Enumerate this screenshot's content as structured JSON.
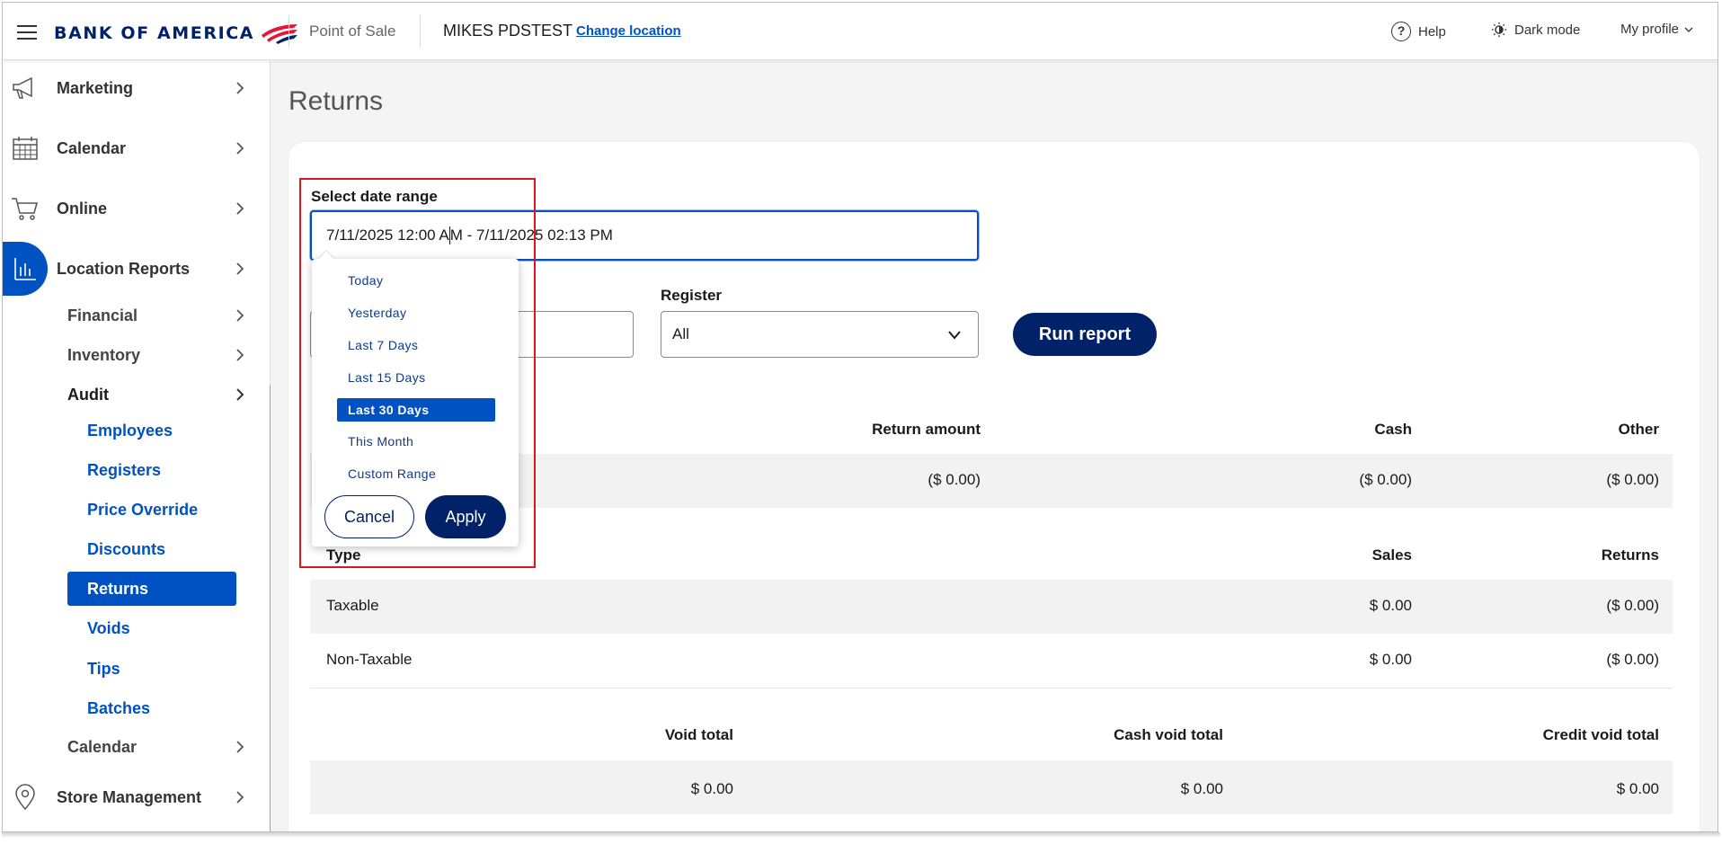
{
  "header": {
    "brand": "BANK OF AMERICA",
    "app_name": "Point of Sale",
    "location_name": "MIKES PDSTEST",
    "change_location": "Change location",
    "help": "Help",
    "dark_mode": "Dark mode",
    "profile": "My profile"
  },
  "sidebar": {
    "top_items": [
      {
        "label": "Marketing",
        "icon": "megaphone-icon"
      },
      {
        "label": "Calendar",
        "icon": "calendar-icon"
      },
      {
        "label": "Online",
        "icon": "cart-icon"
      },
      {
        "label": "Location Reports",
        "icon": "bar-chart-icon",
        "active": true
      },
      {
        "label": "Store Management",
        "icon": "location-pin-icon"
      }
    ],
    "sub_items": [
      "Financial",
      "Inventory",
      "Audit",
      "Calendar"
    ],
    "audit_items": [
      "Employees",
      "Registers",
      "Price Override",
      "Discounts",
      "Returns",
      "Voids",
      "Tips",
      "Batches"
    ],
    "selected": "Returns"
  },
  "main": {
    "title": "Returns",
    "date_label": "Select date range",
    "date_value_a": "7/11/2025 12:00 A",
    "date_value_b": "M - 7/11/2025 02:13 PM",
    "register_label": "Register",
    "register_value": "All",
    "run_report": "Run report"
  },
  "returns_table": {
    "headers": [
      "Return amount",
      "Cash",
      "Other"
    ],
    "row": [
      "($ 0.00)",
      "($ 0.00)",
      "($ 0.00)"
    ]
  },
  "type_table": {
    "headers": [
      "Type",
      "Sales",
      "Returns"
    ],
    "rows": [
      [
        "Taxable",
        "$ 0.00",
        "($ 0.00)"
      ],
      [
        "Non-Taxable",
        "$ 0.00",
        "($ 0.00)"
      ]
    ]
  },
  "void_table": {
    "headers": [
      "Void total",
      "Cash void total",
      "Credit void total"
    ],
    "row": [
      "$ 0.00",
      "$ 0.00",
      "$ 0.00"
    ]
  },
  "date_dropdown": {
    "options": [
      "Today",
      "Yesterday",
      "Last 7 Days",
      "Last 15 Days",
      "Last 30 Days",
      "This Month",
      "Custom Range"
    ],
    "selected": "Last 30 Days",
    "cancel": "Cancel",
    "apply": "Apply"
  },
  "colors": {
    "brand_navy": "#012169",
    "primary_blue": "#0052c2",
    "highlight_red": "#e0151b"
  }
}
